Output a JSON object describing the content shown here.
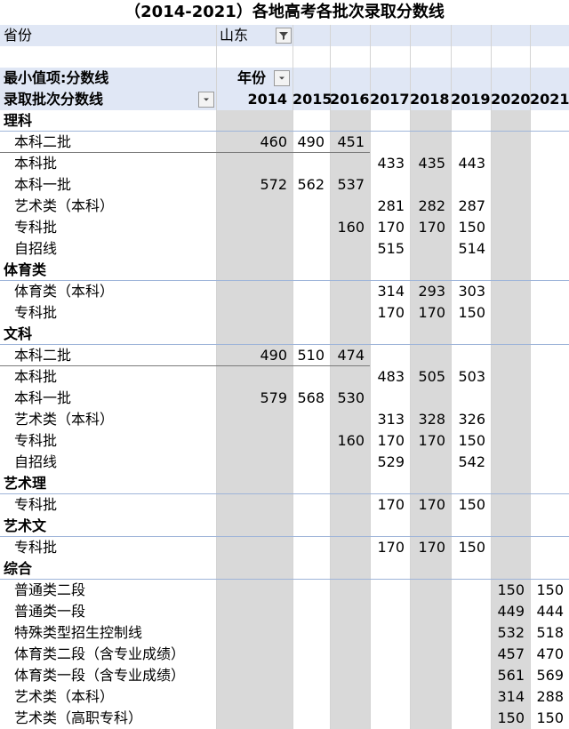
{
  "title": "（2014-2021）各地高考各批次录取分数线",
  "filter": {
    "label": "省份",
    "value": "山东"
  },
  "pivot": {
    "values_label": "最小值项:分数线",
    "col_field": "年份",
    "row_field": "录取批次分数线",
    "years": [
      "2014",
      "2015",
      "2016",
      "2017",
      "2018",
      "2019",
      "2020",
      "2021"
    ]
  },
  "rows": [
    {
      "label": "理科",
      "type": "group",
      "vals": [
        "",
        "",
        "",
        "",
        "",
        "",
        "",
        ""
      ]
    },
    {
      "label": "本科二批",
      "type": "item",
      "vals": [
        "460",
        "490",
        "451",
        "",
        "",
        "",
        "",
        ""
      ]
    },
    {
      "label": "本科批",
      "type": "item",
      "vals": [
        "",
        "",
        "",
        "433",
        "435",
        "443",
        "",
        ""
      ]
    },
    {
      "label": "本科一批",
      "type": "item",
      "vals": [
        "572",
        "562",
        "537",
        "",
        "",
        "",
        "",
        ""
      ]
    },
    {
      "label": "艺术类（本科）",
      "type": "item",
      "vals": [
        "",
        "",
        "",
        "281",
        "282",
        "287",
        "",
        ""
      ]
    },
    {
      "label": "专科批",
      "type": "item",
      "vals": [
        "",
        "",
        "160",
        "170",
        "170",
        "150",
        "",
        ""
      ]
    },
    {
      "label": "自招线",
      "type": "item",
      "vals": [
        "",
        "",
        "",
        "515",
        "",
        "514",
        "",
        ""
      ]
    },
    {
      "label": "体育类",
      "type": "group",
      "vals": [
        "",
        "",
        "",
        "",
        "",
        "",
        "",
        ""
      ]
    },
    {
      "label": "体育类（本科）",
      "type": "item",
      "vals": [
        "",
        "",
        "",
        "314",
        "293",
        "303",
        "",
        ""
      ]
    },
    {
      "label": "专科批",
      "type": "item",
      "vals": [
        "",
        "",
        "",
        "170",
        "170",
        "150",
        "",
        ""
      ]
    },
    {
      "label": "文科",
      "type": "group",
      "vals": [
        "",
        "",
        "",
        "",
        "",
        "",
        "",
        ""
      ]
    },
    {
      "label": "本科二批",
      "type": "item",
      "vals": [
        "490",
        "510",
        "474",
        "",
        "",
        "",
        "",
        ""
      ]
    },
    {
      "label": "本科批",
      "type": "item",
      "vals": [
        "",
        "",
        "",
        "483",
        "505",
        "503",
        "",
        ""
      ]
    },
    {
      "label": "本科一批",
      "type": "item",
      "vals": [
        "579",
        "568",
        "530",
        "",
        "",
        "",
        "",
        ""
      ]
    },
    {
      "label": "艺术类（本科）",
      "type": "item",
      "vals": [
        "",
        "",
        "",
        "313",
        "328",
        "326",
        "",
        ""
      ]
    },
    {
      "label": "专科批",
      "type": "item",
      "vals": [
        "",
        "",
        "160",
        "170",
        "170",
        "150",
        "",
        ""
      ]
    },
    {
      "label": "自招线",
      "type": "item",
      "vals": [
        "",
        "",
        "",
        "529",
        "",
        "542",
        "",
        ""
      ]
    },
    {
      "label": "艺术理",
      "type": "group",
      "vals": [
        "",
        "",
        "",
        "",
        "",
        "",
        "",
        ""
      ]
    },
    {
      "label": "专科批",
      "type": "item",
      "vals": [
        "",
        "",
        "",
        "170",
        "170",
        "150",
        "",
        ""
      ]
    },
    {
      "label": "艺术文",
      "type": "group",
      "vals": [
        "",
        "",
        "",
        "",
        "",
        "",
        "",
        ""
      ]
    },
    {
      "label": "专科批",
      "type": "item",
      "vals": [
        "",
        "",
        "",
        "170",
        "170",
        "150",
        "",
        ""
      ]
    },
    {
      "label": "综合",
      "type": "group",
      "vals": [
        "",
        "",
        "",
        "",
        "",
        "",
        "",
        ""
      ]
    },
    {
      "label": "普通类二段",
      "type": "item",
      "vals": [
        "",
        "",
        "",
        "",
        "",
        "",
        "150",
        "150"
      ]
    },
    {
      "label": "普通类一段",
      "type": "item",
      "vals": [
        "",
        "",
        "",
        "",
        "",
        "",
        "449",
        "444"
      ]
    },
    {
      "label": "特殊类型招生控制线",
      "type": "item",
      "vals": [
        "",
        "",
        "",
        "",
        "",
        "",
        "532",
        "518"
      ]
    },
    {
      "label": "体育类二段（含专业成绩）",
      "type": "item",
      "vals": [
        "",
        "",
        "",
        "",
        "",
        "",
        "457",
        "470"
      ]
    },
    {
      "label": "体育类一段（含专业成绩）",
      "type": "item",
      "vals": [
        "",
        "",
        "",
        "",
        "",
        "",
        "561",
        "569"
      ]
    },
    {
      "label": "艺术类（本科）",
      "type": "item",
      "vals": [
        "",
        "",
        "",
        "",
        "",
        "",
        "314",
        "288"
      ]
    },
    {
      "label": "艺术类（高职专科）",
      "type": "item",
      "vals": [
        "",
        "",
        "",
        "",
        "",
        "",
        "150",
        "150"
      ]
    }
  ]
}
